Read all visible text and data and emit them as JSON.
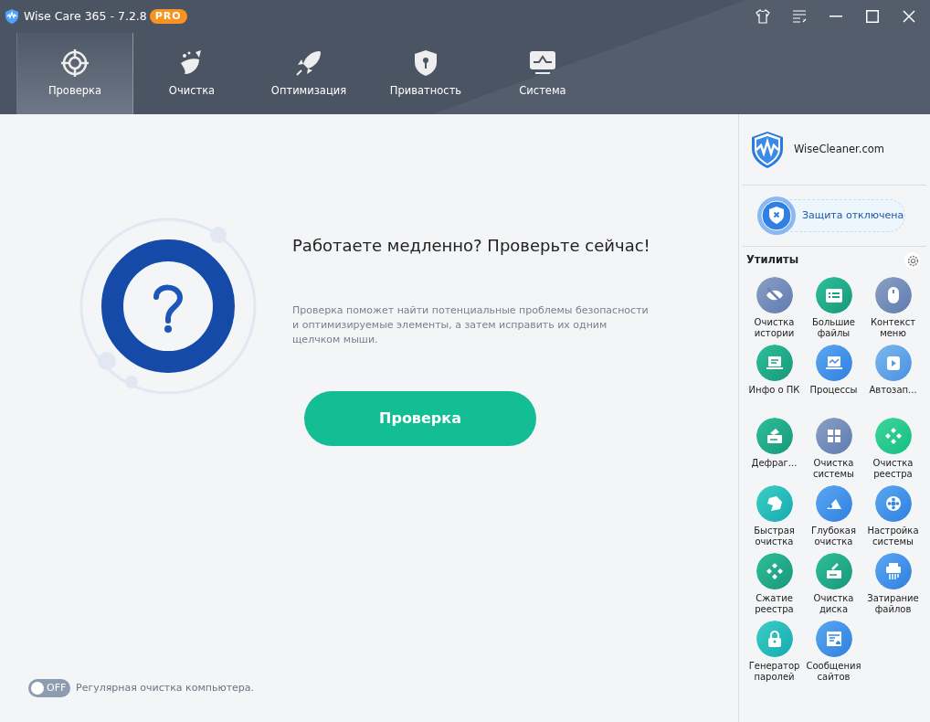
{
  "window": {
    "title": "Wise Care 365 - 7.2.8",
    "badge": "PRO"
  },
  "tabs": [
    {
      "label": "Проверка",
      "selected": true
    },
    {
      "label": "Очистка",
      "selected": false
    },
    {
      "label": "Оптимизация",
      "selected": false
    },
    {
      "label": "Приватность",
      "selected": false
    },
    {
      "label": "Система",
      "selected": false
    }
  ],
  "main": {
    "heading": "Работаете медленно? Проверьте сейчас!",
    "description": "Проверка поможет найти потенциальные проблемы безопасности и оптимизируемые элементы, а затем исправить их одним щелчком мыши.",
    "button": "Проверка"
  },
  "schedule": {
    "on": false,
    "toggle_text": "OFF",
    "label": "Регулярная очистка компьютера."
  },
  "sidebar": {
    "site": "WiseCleaner.com",
    "protection": "Защита отключена",
    "utilities_title": "Утилиты",
    "tools": [
      {
        "label": "Очистка истории"
      },
      {
        "label": "Большие файлы"
      },
      {
        "label": "Контекст меню"
      },
      {
        "label": "Инфо о ПК"
      },
      {
        "label": "Процессы"
      },
      {
        "label": "Автозап..."
      },
      {
        "label": "Дефраг..."
      },
      {
        "label": "Очистка системы"
      },
      {
        "label": "Очистка реестра"
      },
      {
        "label": "Быстрая очистка"
      },
      {
        "label": "Глубокая очистка"
      },
      {
        "label": "Настройка системы"
      },
      {
        "label": "Сжатие реестра"
      },
      {
        "label": "Очистка диска"
      },
      {
        "label": "Затирание файлов"
      },
      {
        "label": "Генератор паролей"
      },
      {
        "label": "Сообщения сайтов"
      }
    ]
  }
}
